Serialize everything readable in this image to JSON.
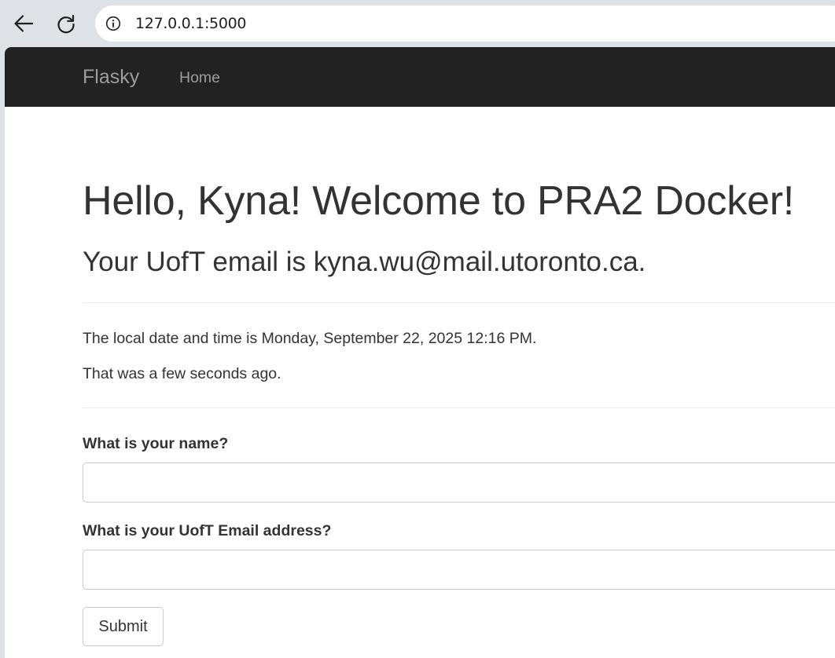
{
  "browser": {
    "url": "127.0.0.1:5000",
    "icons": [
      "back-arrow-icon",
      "reload-icon",
      "site-info-icon"
    ]
  },
  "navbar": {
    "brand": "Flasky",
    "home": "Home",
    "background": "#222222",
    "text_color": "#9d9d9d"
  },
  "content": {
    "greeting": "Hello, Kyna! Welcome to PRA2 Docker!",
    "email_line": "Your UofT email is kyna.wu@mail.utoronto.ca.",
    "local_time": "The local date and time is Monday, September 22, 2025 12:16 PM.",
    "ago": "That was a few seconds ago."
  },
  "form": {
    "name_label": "What is your name?",
    "name_value": "",
    "email_label": "What is your UofT Email address?",
    "email_value": "",
    "submit_label": "Submit"
  }
}
